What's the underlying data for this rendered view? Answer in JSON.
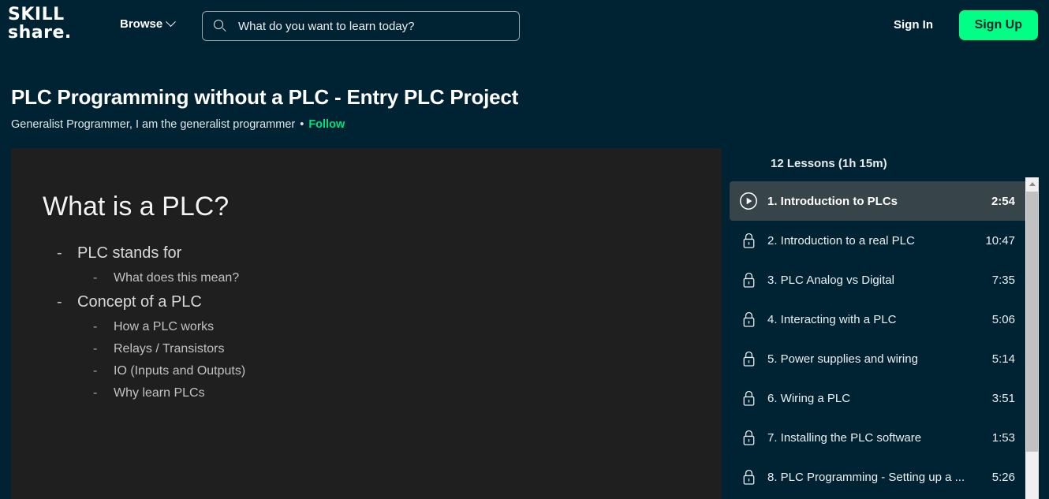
{
  "header": {
    "logo_line1": "SKILL",
    "logo_line2": "share.",
    "browse_label": "Browse",
    "search_placeholder": "What do you want to learn today?",
    "search_value": "",
    "signin_label": "Sign In",
    "signup_label": "Sign Up",
    "accent_green": "#00ff84",
    "background": "#002333"
  },
  "course": {
    "title": "PLC Programming without a PLC - Entry PLC Project",
    "author": "Generalist Programmer, I am the generalist programmer",
    "separator": "•",
    "follow_label": "Follow",
    "follow_color": "#00e07a"
  },
  "player": {
    "slide_title": "What is a PLC?",
    "bullets": [
      {
        "level": 1,
        "text": "PLC stands for"
      },
      {
        "level": 2,
        "text": "What does this mean?"
      },
      {
        "level": 1,
        "text": "Concept of a PLC"
      },
      {
        "level": 2,
        "text": "How a PLC works"
      },
      {
        "level": 2,
        "text": "Relays / Transistors"
      },
      {
        "level": 2,
        "text": "IO (Inputs and Outputs)"
      },
      {
        "level": 2,
        "text": "Why learn PLCs"
      }
    ]
  },
  "lessons": {
    "summary": "12 Lessons (1h 15m)",
    "active_row_color": "#37444a",
    "items": [
      {
        "label": "1. Introduction to PLCs",
        "time": "2:54",
        "icon": "play-circle-icon",
        "state": "active"
      },
      {
        "label": "2. Introduction to a real PLC",
        "time": "10:47",
        "icon": "lock-icon",
        "state": "locked"
      },
      {
        "label": "3. PLC Analog vs Digital",
        "time": "7:35",
        "icon": "lock-icon",
        "state": "locked"
      },
      {
        "label": "4. Interacting with a PLC",
        "time": "5:06",
        "icon": "lock-icon",
        "state": "locked"
      },
      {
        "label": "5. Power supplies and wiring",
        "time": "5:14",
        "icon": "lock-icon",
        "state": "locked"
      },
      {
        "label": "6. Wiring a PLC",
        "time": "3:51",
        "icon": "lock-icon",
        "state": "locked"
      },
      {
        "label": "7. Installing the PLC software",
        "time": "1:53",
        "icon": "lock-icon",
        "state": "locked"
      },
      {
        "label": "8. PLC Programming - Setting up a ...",
        "time": "5:26",
        "icon": "lock-icon",
        "state": "locked"
      }
    ]
  }
}
